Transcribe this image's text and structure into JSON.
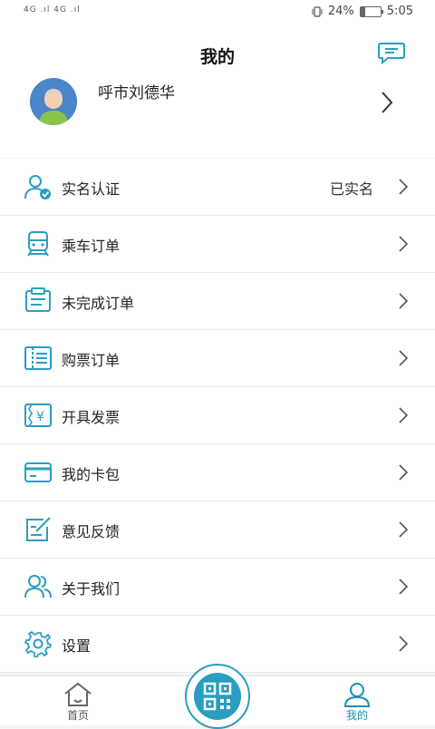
{
  "status": {
    "network": "4G .ıl 4G .ıl",
    "battery": "24%",
    "time": "5:05",
    "battery_level": 0.24
  },
  "header": {
    "title": "我的",
    "username": "呼市刘德华"
  },
  "menu": [
    {
      "label": "实名认证",
      "value": "已实名",
      "icon": "id-verify-icon"
    },
    {
      "label": "乘车订单",
      "icon": "train-icon"
    },
    {
      "label": "未完成订单",
      "icon": "unfinished-order-icon"
    },
    {
      "label": "购票订单",
      "icon": "ticket-icon"
    },
    {
      "label": "开具发票",
      "icon": "invoice-icon"
    },
    {
      "label": "我的卡包",
      "icon": "card-icon"
    },
    {
      "label": "意见反馈",
      "icon": "feedback-icon"
    },
    {
      "label": "关于我们",
      "icon": "users-icon"
    },
    {
      "label": "设置",
      "icon": "gear-icon"
    }
  ],
  "tabs": {
    "home": "首页",
    "mine": "我的"
  },
  "colors": {
    "accent": "#1f8fb3",
    "background": "#f4f5f7"
  }
}
